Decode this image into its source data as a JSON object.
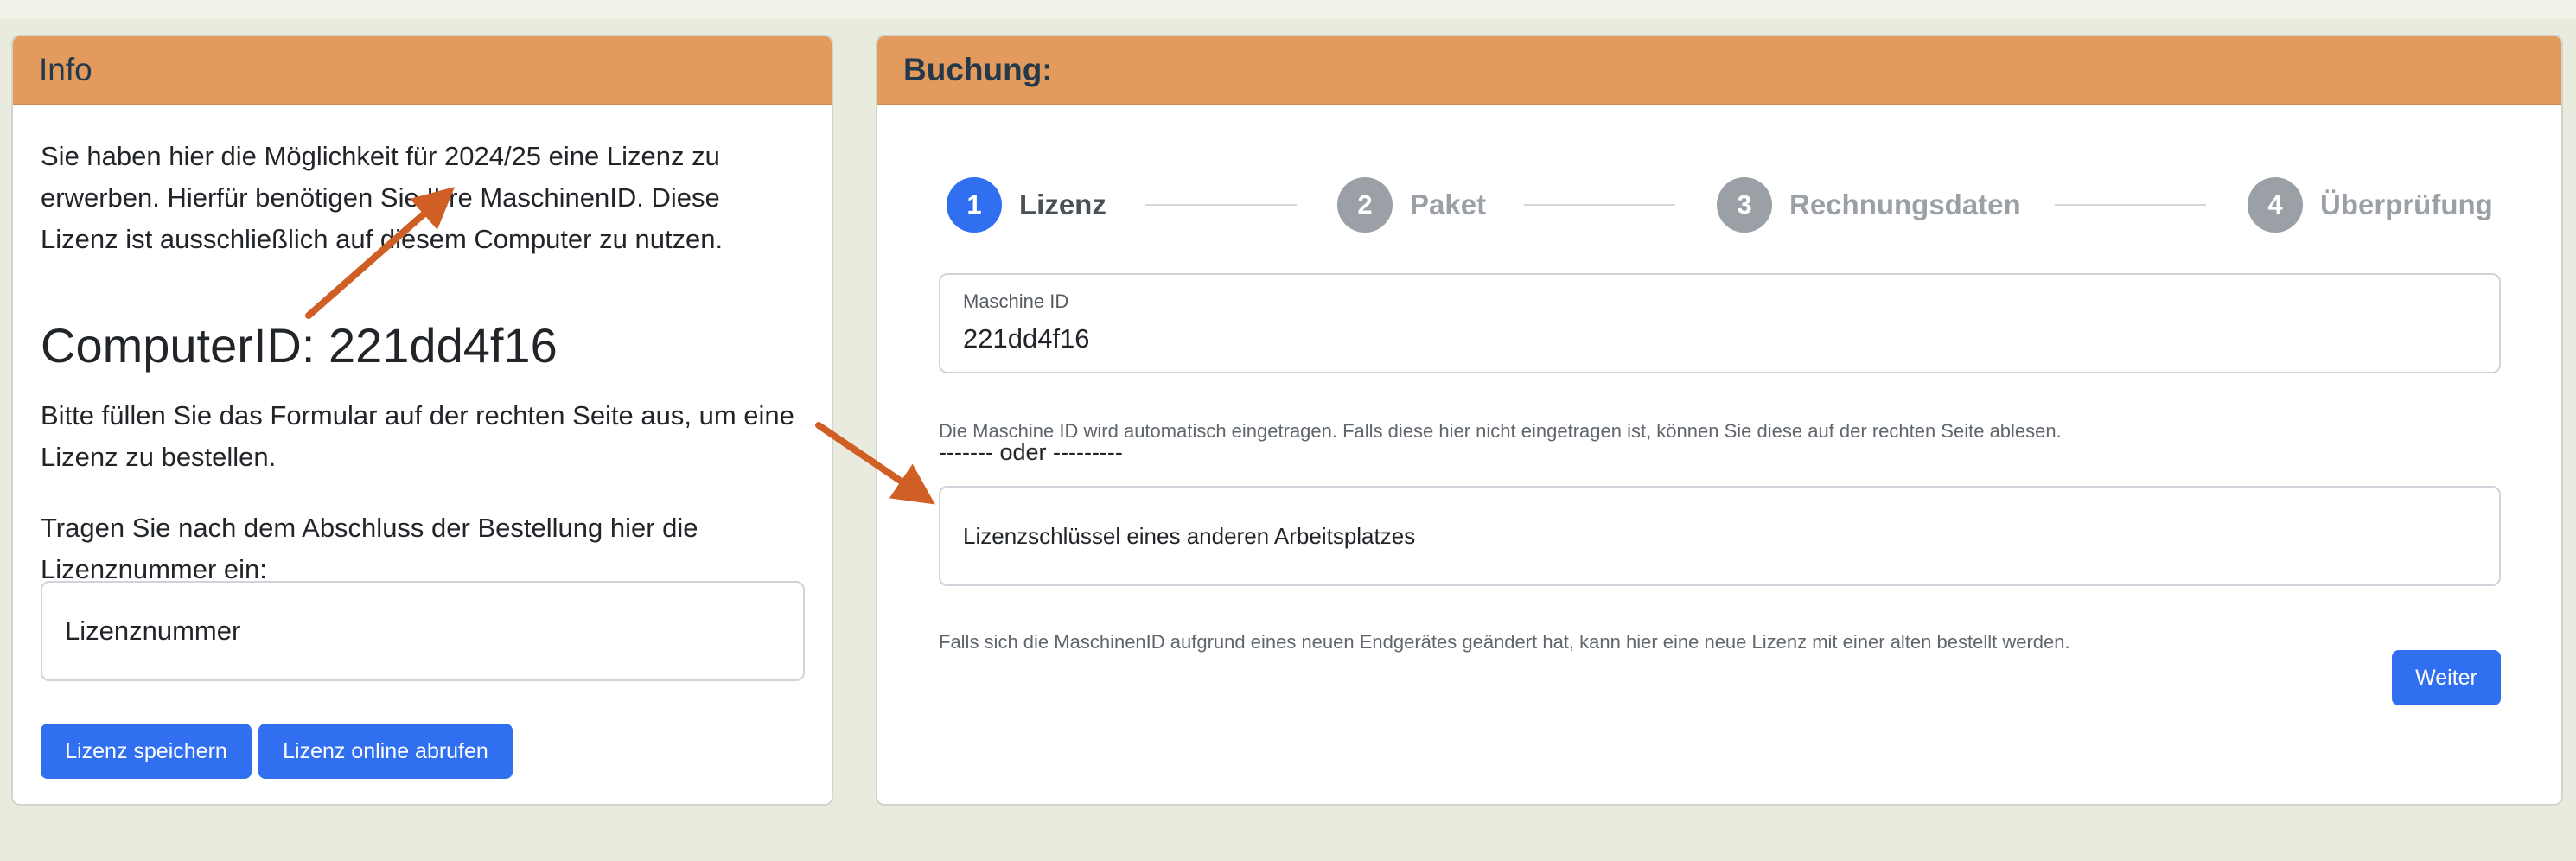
{
  "info": {
    "title": "Info",
    "intro_text": "Sie haben hier die Möglichkeit für 2024/25 eine Lizenz zu erwerben. Hierfür benötigen Sie Ihre MaschinenID. Diese Lizenz ist ausschließlich auf diesem Computer zu nutzen.",
    "computer_id": "ComputerID: 221dd4f16",
    "fill_text": "Bitte füllen Sie das Formular auf der rechten Seite aus, um eine Lizenz zu bestellen.",
    "enter_text": "Tragen Sie nach dem Abschluss der Bestellung hier die Lizenznummer ein:",
    "license_placeholder": "Lizenznummer",
    "save_button": "Lizenz speichern",
    "online_button": "Lizenz online abrufen"
  },
  "booking": {
    "title": "Buchung:",
    "steps": [
      {
        "number": "1",
        "label": "Lizenz"
      },
      {
        "number": "2",
        "label": "Paket"
      },
      {
        "number": "3",
        "label": "Rechnungsdaten"
      },
      {
        "number": "4",
        "label": "Überprüfung"
      }
    ],
    "machine_label": "Maschine ID",
    "machine_value": "221dd4f16",
    "machine_help": "Die Maschine ID wird automatisch eingetragen. Falls diese hier nicht eingetragen ist, können Sie diese auf der rechten Seite ablesen.",
    "divider": "------- oder ---------",
    "key_placeholder": "Lizenzschlüssel eines anderen Arbeitsplatzes",
    "key_help": "Falls sich die MaschinenID aufgrund eines neuen Endgerätes geändert hat, kann hier eine neue Lizenz mit einer alten bestellt werden.",
    "next_button": "Weiter"
  },
  "colors": {
    "header": "#e29b5c",
    "primary": "#2f6ff0",
    "arrow": "#cf5f25"
  }
}
